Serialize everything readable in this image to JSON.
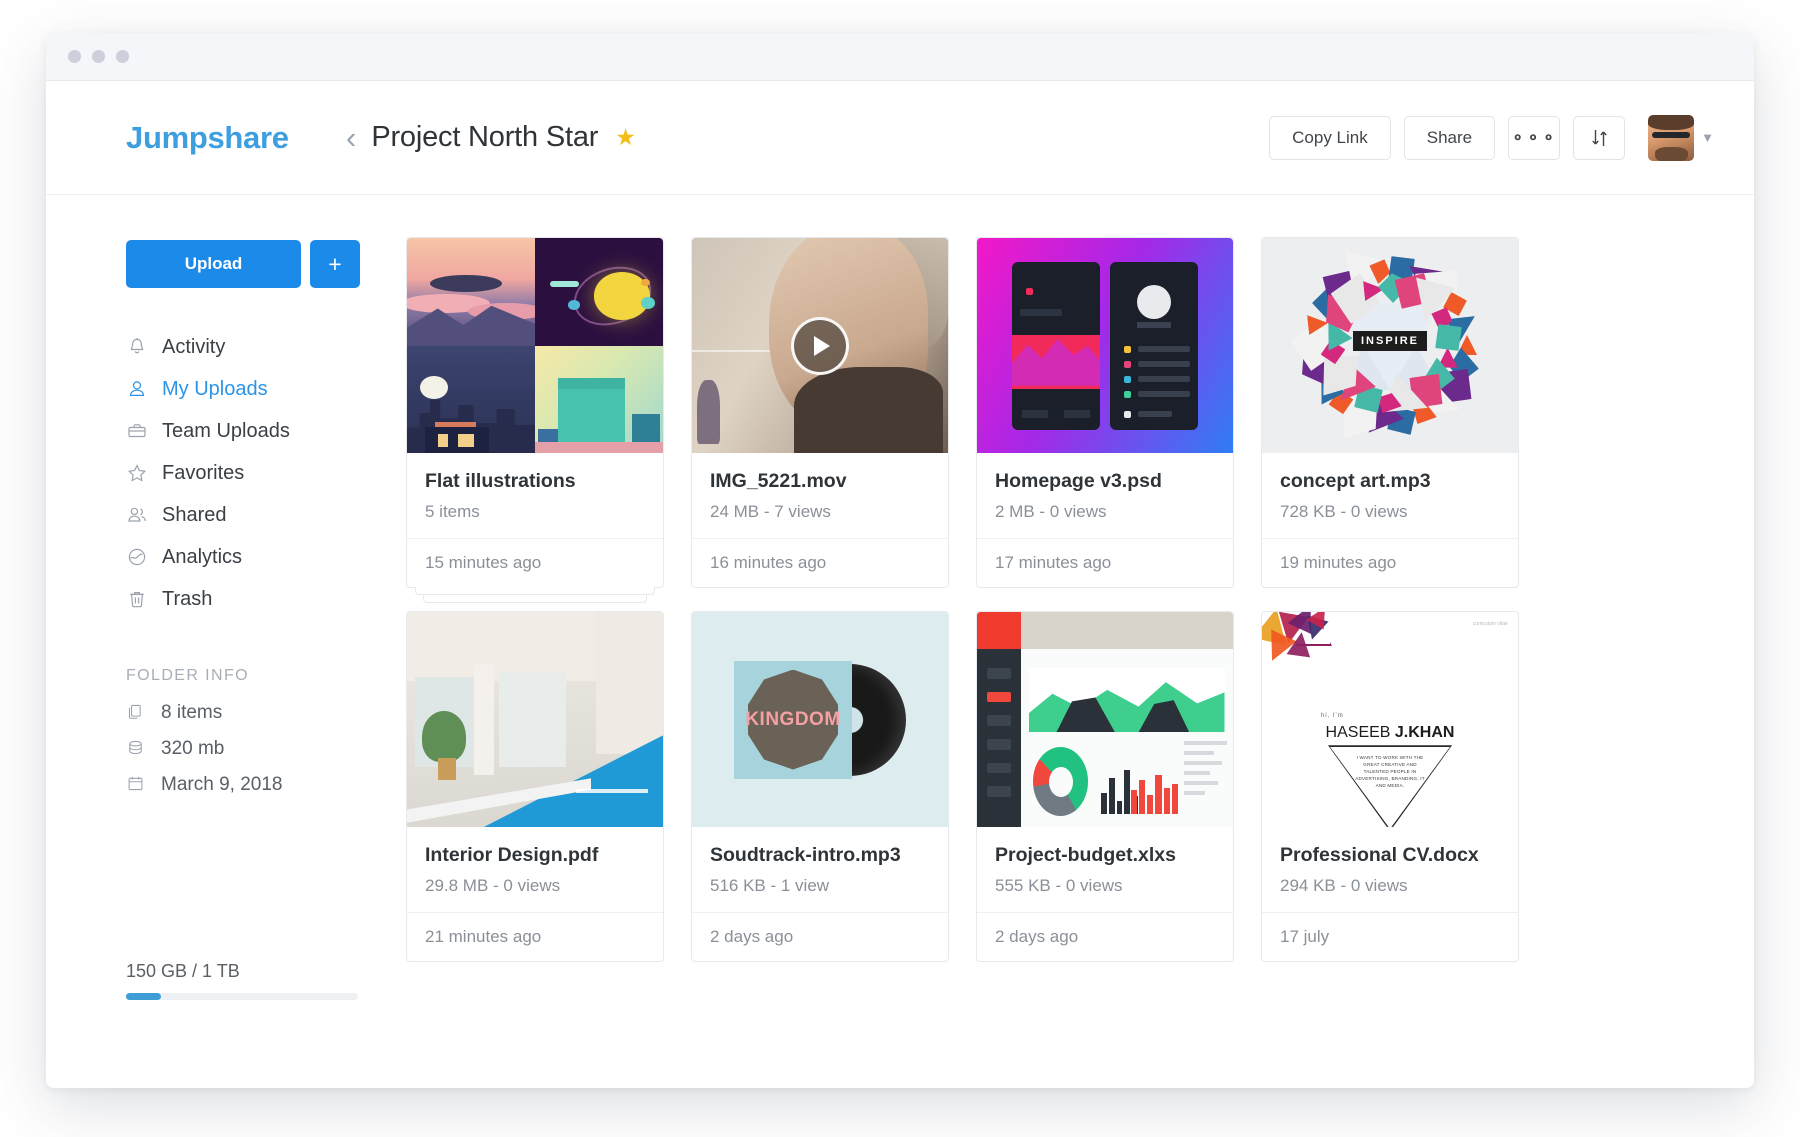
{
  "window": {
    "traffic_lights": [
      "close",
      "minimize",
      "zoom"
    ]
  },
  "header": {
    "logo": "Jumpshare",
    "back_icon": "chevron-left-icon",
    "folder_title": "Project North Star",
    "favorite_icon": "star-icon",
    "copy_link_label": "Copy Link",
    "share_label": "Share",
    "more_label": "ooo",
    "sort_icon": "sort-icon",
    "avatar_icon": "user-avatar",
    "caret_icon": "chevron-down-icon"
  },
  "sidebar": {
    "upload_label": "Upload",
    "add_label": "+",
    "items": [
      {
        "label": "Activity",
        "icon": "bell-icon",
        "active": false
      },
      {
        "label": "My Uploads",
        "icon": "user-icon",
        "active": true
      },
      {
        "label": "Team Uploads",
        "icon": "briefcase-icon",
        "active": false
      },
      {
        "label": "Favorites",
        "icon": "star-icon",
        "active": false
      },
      {
        "label": "Shared",
        "icon": "people-icon",
        "active": false
      },
      {
        "label": "Analytics",
        "icon": "chart-icon",
        "active": false
      },
      {
        "label": "Trash",
        "icon": "trash-icon",
        "active": false
      }
    ],
    "folder_info_title": "FOLDER INFO",
    "folder_info": [
      {
        "label": "8 items",
        "icon": "files-icon"
      },
      {
        "label": "320 mb",
        "icon": "database-icon"
      },
      {
        "label": "March 9, 2018",
        "icon": "calendar-icon"
      }
    ],
    "storage": {
      "label": "150 GB / 1 TB",
      "used_percent": 15
    }
  },
  "files": [
    {
      "name": "Flat illustrations",
      "sub": "5 items",
      "date": "15 minutes ago",
      "type": "folder"
    },
    {
      "name": "IMG_5221.mov",
      "sub": "24 MB - 7 views",
      "date": "16 minutes ago",
      "type": "video"
    },
    {
      "name": "Homepage v3.psd",
      "sub": "2 MB - 0 views",
      "date": "17 minutes ago",
      "type": "psd"
    },
    {
      "name": "concept art.mp3",
      "sub": "728 KB - 0 views",
      "date": "19 minutes ago",
      "type": "art"
    },
    {
      "name": "Interior Design.pdf",
      "sub": "29.8 MB - 0 views",
      "date": "21 minutes ago",
      "type": "pdf"
    },
    {
      "name": "Soudtrack-intro.mp3",
      "sub": "516 KB - 1 view",
      "date": "2 days ago",
      "type": "audio"
    },
    {
      "name": "Project-budget.xlxs",
      "sub": "555 KB - 0 views",
      "date": "2 days ago",
      "type": "xls"
    },
    {
      "name": "Professional CV.docx",
      "sub": "294 KB - 0 views",
      "date": "17 july",
      "type": "doc"
    }
  ],
  "thumbnails": {
    "concept_art_badge": "INSPIRE",
    "soundtrack_title": "KINGDOM",
    "cv_name_first": "HASEEB ",
    "cv_name_last": "J.KHAN",
    "cv_supra": "hi, I'm",
    "cv_blurb": "I WANT TO WORK WITH THE GREAT CREATIVE AND TALENTED PEOPLE IN ADVERTISING, BRANDING, IT AND MEDIA.",
    "cv_corner": "curriculum vitae"
  },
  "colors": {
    "brand_blue": "#1c8ae8",
    "logo_blue": "#3d9ee0",
    "star_yellow": "#f5bd18",
    "text_dark": "#2f3438",
    "text_muted": "#8a9098"
  }
}
